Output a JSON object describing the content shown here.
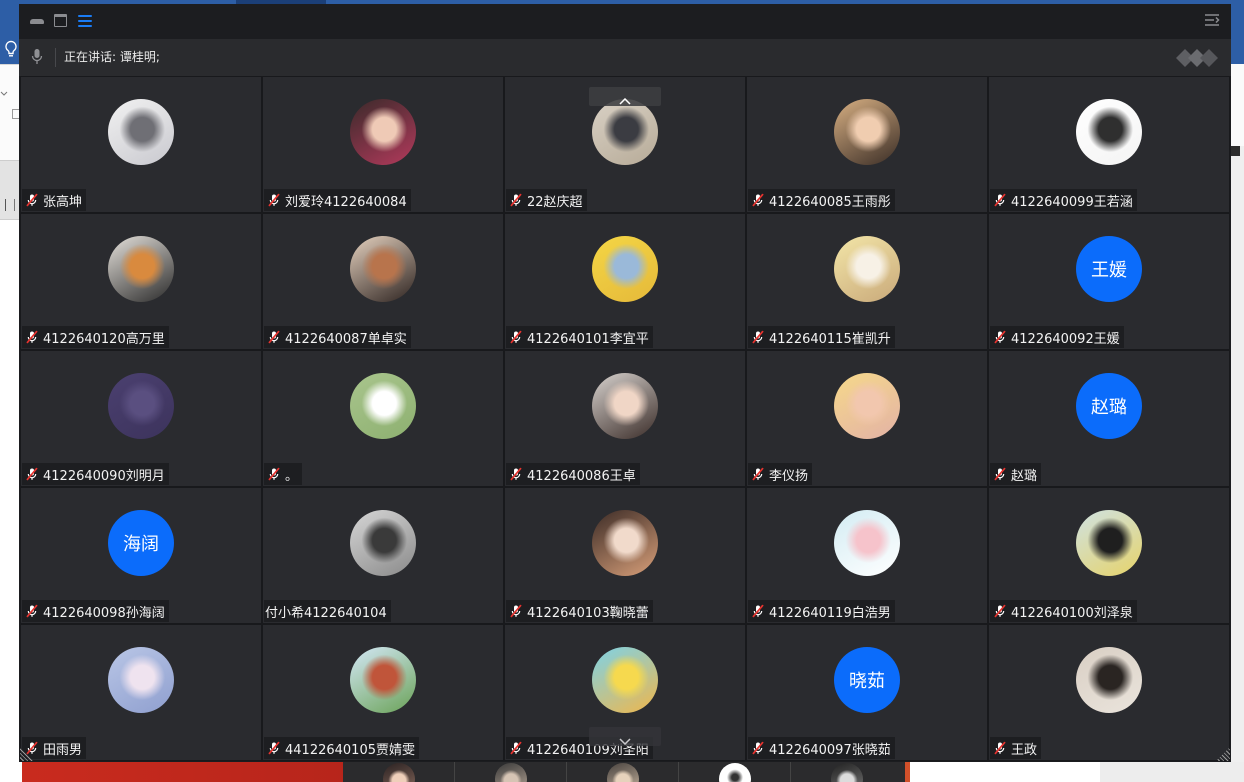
{
  "window": {
    "title_bar": {
      "left_icons": [
        "minimize-icon",
        "maximize-icon",
        "list-layout-icon"
      ],
      "right_icon": "sidebar-collapse-icon"
    },
    "speaker_bar": {
      "icon": "microphone-icon",
      "speaking_text": "正在讲话: 谭桂明;",
      "logo_icon": "app-logo-icon"
    },
    "grid": {
      "scroll_up_icon": "chevron-up-icon",
      "scroll_down_icon": "chevron-down-icon"
    }
  },
  "colors": {
    "accent_blue": "#1a7cf5",
    "avatar_blue": "#0b6cfb",
    "muted_red": "#e5332f",
    "tile_bg": "#2a2b2f",
    "title_bar_bg": "#1c1d20",
    "speaker_bar_bg": "#2a2b2e",
    "label_bg": "#1d1e21",
    "label_text": "#f3f3f3"
  },
  "participants": [
    {
      "name": "张高坤",
      "mic_icon": "mic-muted-icon",
      "avatar_colors": [
        "#f1f1f1",
        "#6f6f75",
        "#c9c9cf"
      ]
    },
    {
      "name": "刘爱玲4122640084",
      "mic_icon": "mic-muted-icon",
      "avatar_colors": [
        "#3a2a2a",
        "#efcab6",
        "#b33a5c"
      ]
    },
    {
      "name": "22赵庆超",
      "mic_icon": "mic-muted-icon",
      "avatar_colors": [
        "#d9d1c5",
        "#3b3c42",
        "#b7ab98"
      ]
    },
    {
      "name": "4122640085王雨彤",
      "mic_icon": "mic-muted-icon",
      "avatar_colors": [
        "#d8b083",
        "#f0cdb0",
        "#3a2d26"
      ]
    },
    {
      "name": "4122640099王若涵",
      "mic_icon": "mic-muted-icon",
      "avatar_colors": [
        "#ffffff",
        "#2f2f2f",
        "#f4f4f4"
      ]
    },
    {
      "name": "4122640120高万里",
      "mic_icon": "mic-muted-icon",
      "avatar_colors": [
        "#e6e2dc",
        "#d98a3e",
        "#2a2a2a"
      ]
    },
    {
      "name": "4122640087单卓实",
      "mic_icon": "mic-muted-icon",
      "avatar_colors": [
        "#e6d2bf",
        "#b8744c",
        "#2d2320"
      ]
    },
    {
      "name": "4122640101李宜平",
      "mic_icon": "mic-muted-icon",
      "avatar_colors": [
        "#f4d645",
        "#9ab9d9",
        "#e5b93a"
      ]
    },
    {
      "name": "4122640115崔凯升",
      "mic_icon": "mic-muted-icon",
      "avatar_colors": [
        "#f3e6a8",
        "#f7f1e6",
        "#c9a97a"
      ]
    },
    {
      "name": "4122640092王媛",
      "mic_icon": "mic-muted-icon",
      "avatar_text": "王媛",
      "avatar_color": "#0b6cfb"
    },
    {
      "name": "4122640090刘明月",
      "mic_icon": "mic-muted-icon",
      "avatar_colors": [
        "#4b4070",
        "#5a4f80",
        "#3c335c"
      ]
    },
    {
      "name": "。",
      "mic_icon": "mic-muted-icon",
      "avatar_colors": [
        "#a9c58d",
        "#ffffff",
        "#8db070"
      ]
    },
    {
      "name": "4122640086王卓",
      "mic_icon": "mic-muted-icon",
      "avatar_colors": [
        "#d8d3cf",
        "#f0d6c6",
        "#3a2c28"
      ]
    },
    {
      "name": "李仪扬",
      "mic_icon": "mic-muted-icon",
      "avatar_colors": [
        "#f6d98a",
        "#f2c7ae",
        "#e3b2a6"
      ]
    },
    {
      "name": "赵璐",
      "mic_icon": "mic-muted-icon",
      "avatar_text": "赵璐",
      "avatar_color": "#0b6cfb"
    },
    {
      "name": "4122640098孙海阔",
      "mic_icon": "mic-muted-icon",
      "avatar_text": "海阔",
      "avatar_color": "#0b6cfb"
    },
    {
      "name": "付小希4122640104",
      "mic_icon": null,
      "avatar_colors": [
        "#d6d6d6",
        "#3a3a3a",
        "#8a8a8a"
      ]
    },
    {
      "name": "4122640103鞠晓蕾",
      "mic_icon": "mic-muted-icon",
      "avatar_colors": [
        "#3b2b26",
        "#f1dacb",
        "#d9a07a"
      ]
    },
    {
      "name": "4122640119白浩男",
      "mic_icon": "mic-muted-icon",
      "avatar_colors": [
        "#d3ecf3",
        "#f6c3cb",
        "#ffffff"
      ]
    },
    {
      "name": "4122640100刘泽泉",
      "mic_icon": "mic-muted-icon",
      "avatar_colors": [
        "#cfe2e2",
        "#1f1f1f",
        "#e6d36a"
      ]
    },
    {
      "name": "田雨男",
      "mic_icon": "mic-muted-icon",
      "avatar_colors": [
        "#b9c6e6",
        "#efe3ef",
        "#8f9fcf"
      ]
    },
    {
      "name": "44122640105贾婧雯",
      "mic_icon": "mic-muted-icon",
      "avatar_colors": [
        "#d4e8f7",
        "#c0553a",
        "#6aa257"
      ]
    },
    {
      "name": "4122640109刘圣阳",
      "mic_icon": "mic-muted-icon",
      "avatar_colors": [
        "#7dd3e8",
        "#f6d94e",
        "#f0b64a"
      ]
    },
    {
      "name": "4122640097张晓茹",
      "mic_icon": "mic-muted-icon",
      "avatar_text": "晓茹",
      "avatar_color": "#0b6cfb"
    },
    {
      "name": "王政",
      "mic_icon": "mic-muted-icon",
      "avatar_colors": [
        "#d9cfc4",
        "#2a2522",
        "#eae4dc"
      ]
    }
  ]
}
